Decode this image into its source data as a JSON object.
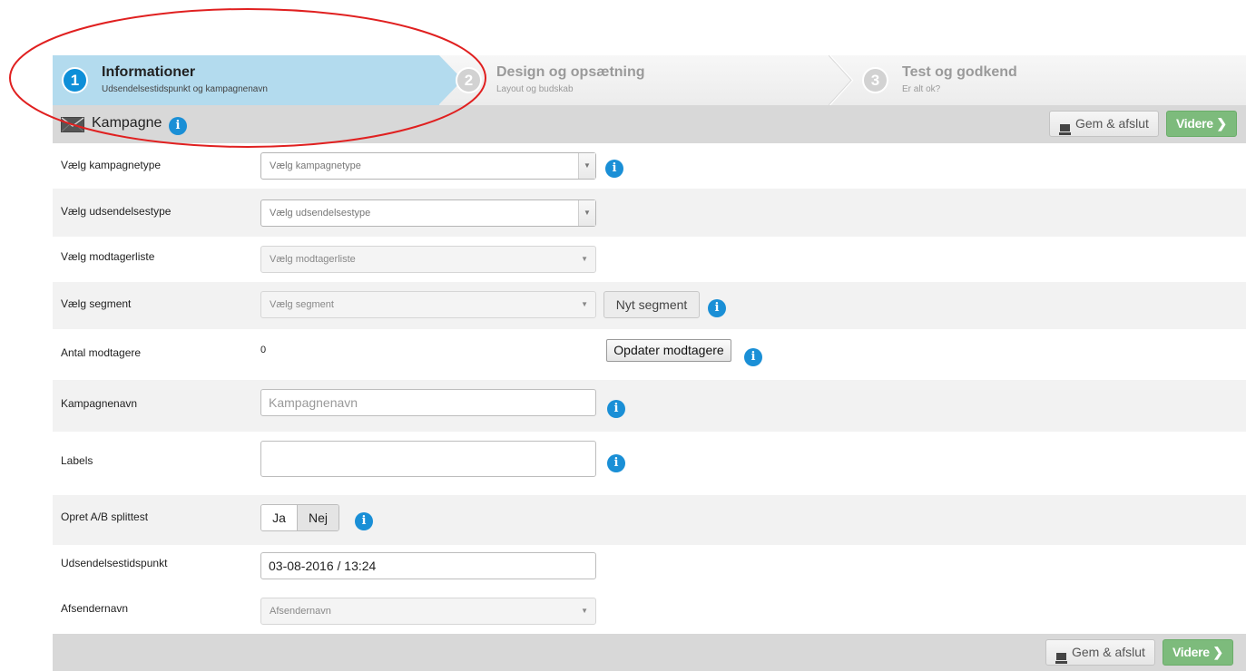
{
  "wizard": {
    "steps": [
      {
        "number": "1",
        "title": "Informationer",
        "subtitle": "Udsendelsestidspunkt og kampagnenavn",
        "state": "active"
      },
      {
        "number": "2",
        "title": "Design og opsætning",
        "subtitle": "Layout og budskab",
        "state": "inactive"
      },
      {
        "number": "3",
        "title": "Test og godkend",
        "subtitle": "Er alt ok?",
        "state": "inactive"
      }
    ]
  },
  "header": {
    "title": "Kampagne",
    "icon": "envelope-icon",
    "save_label": "Gem & afslut",
    "next_label": "Videre"
  },
  "form": {
    "campaign_type": {
      "label": "Vælg kampagnetype",
      "placeholder": "Vælg kampagnetype"
    },
    "send_type": {
      "label": "Vælg udsendelsestype",
      "placeholder": "Vælg udsendelsestype"
    },
    "recipient_list": {
      "label": "Vælg modtagerliste",
      "placeholder": "Vælg modtagerliste"
    },
    "segment": {
      "label": "Vælg segment",
      "placeholder": "Vælg segment",
      "new_button": "Nyt segment"
    },
    "recipient_count": {
      "label": "Antal modtagere",
      "value": "0",
      "update_button": "Opdater modtagere"
    },
    "campaign_name": {
      "label": "Kampagnenavn",
      "placeholder": "Kampagnenavn",
      "value": ""
    },
    "labels": {
      "label": "Labels",
      "value": ""
    },
    "ab_test": {
      "label": "Opret A/B splittest",
      "options": [
        "Ja",
        "Nej"
      ],
      "selected": "Nej"
    },
    "send_time": {
      "label": "Udsendelsestidspunkt",
      "value": "03-08-2016 / 13:24"
    },
    "sender_name": {
      "label": "Afsendernavn",
      "placeholder": "Afsendernavn"
    }
  },
  "footer": {
    "save_label": "Gem & afslut",
    "next_label": "Videre"
  },
  "colors": {
    "active_step": "#b3dbee",
    "accent_blue": "#1a8fd6",
    "next_button": "#7dbb7c",
    "annotation": "#e02020"
  },
  "info_icon_glyph": "i"
}
